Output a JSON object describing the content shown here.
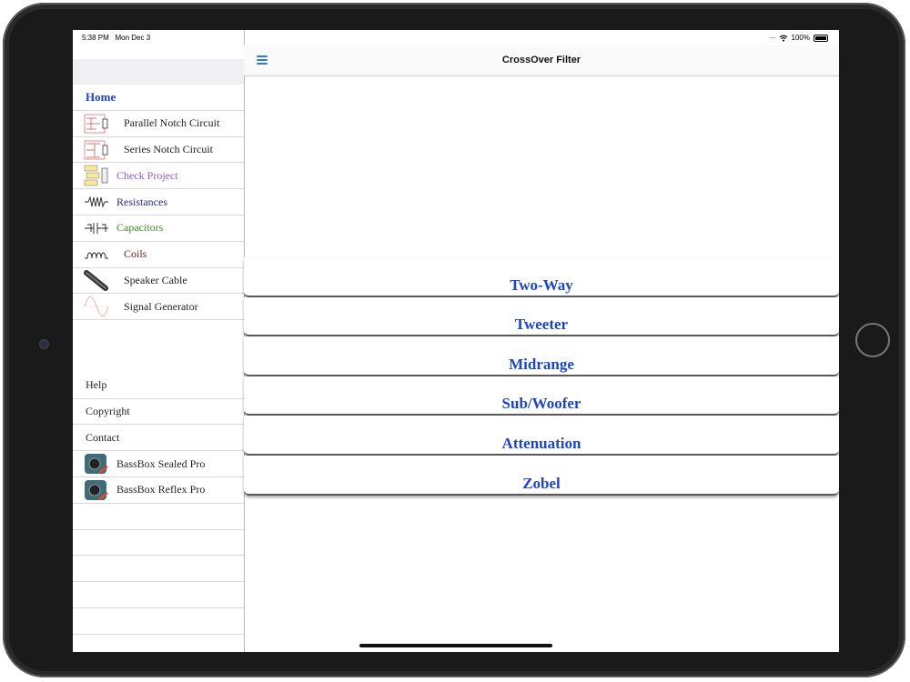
{
  "status": {
    "time": "5:38 PM",
    "date": "Mon Dec 3",
    "battery": "100%"
  },
  "header": {
    "title": "CrossOver Filter"
  },
  "sidebar": {
    "home": "Home",
    "items": [
      {
        "label": "Parallel Notch Circuit",
        "color": "#222222"
      },
      {
        "label": "Series Notch Circuit",
        "color": "#222222"
      },
      {
        "label": "Check Project",
        "color": "#8a5bd6"
      },
      {
        "label": "Resistances",
        "color": "#2a2a8a"
      },
      {
        "label": "Capacitors",
        "color": "#3f8a2a"
      },
      {
        "label": "Coils",
        "color": "#6a1a1a"
      },
      {
        "label": "Speaker Cable",
        "color": "#222222"
      },
      {
        "label": "Signal Generator",
        "color": "#222222"
      }
    ],
    "links": [
      "Help",
      "Copyright",
      "Contact"
    ],
    "apps": [
      "BassBox Sealed Pro",
      "BassBox Reflex Pro"
    ]
  },
  "main": {
    "buttons": [
      "Two-Way",
      "Tweeter",
      "Midrange",
      "Sub/Woofer",
      "Attenuation",
      "Zobel"
    ]
  },
  "colors": {
    "accent": "#1c46c2",
    "menu": "#2a7ae2"
  }
}
